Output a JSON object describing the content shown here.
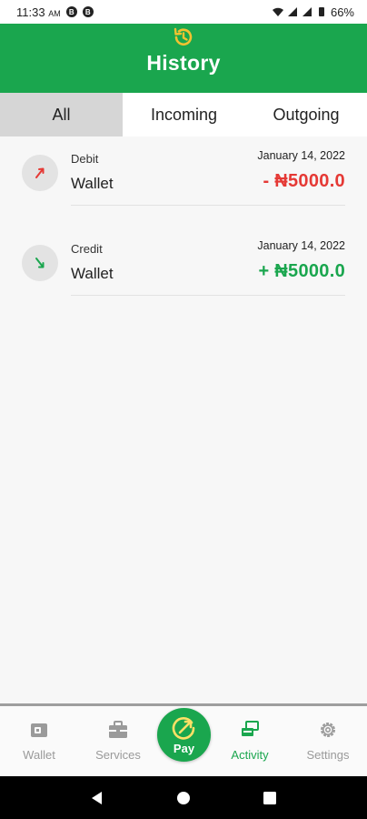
{
  "status_bar": {
    "time": "11:33",
    "ampm": "AM",
    "battery": "66%",
    "icons": [
      "notification-badge-icon",
      "notification-badge-icon",
      "wifi-icon",
      "signal-icon",
      "signal-icon",
      "battery-icon"
    ]
  },
  "header": {
    "title": "History",
    "icon": "history-icon"
  },
  "tabs": [
    {
      "label": "All",
      "active": true
    },
    {
      "label": "Incoming",
      "active": false
    },
    {
      "label": "Outgoing",
      "active": false
    }
  ],
  "transactions": [
    {
      "type": "Debit",
      "account": "Wallet",
      "date": "January 14, 2022",
      "amount": "- ₦5000.0",
      "direction": "out",
      "color": "#e53935",
      "icon": "arrow-up-right-icon"
    },
    {
      "type": "Credit",
      "account": "Wallet",
      "date": "January 14, 2022",
      "amount": "+ ₦5000.0",
      "direction": "in",
      "color": "#1aa64e",
      "icon": "arrow-down-right-icon"
    }
  ],
  "bottom_nav": {
    "items": [
      {
        "label": "Wallet",
        "icon": "wallet-icon",
        "active": false
      },
      {
        "label": "Services",
        "icon": "briefcase-icon",
        "active": false
      },
      {
        "label": "Activity",
        "icon": "activity-icon",
        "active": true
      },
      {
        "label": "Settings",
        "icon": "gear-icon",
        "active": false
      }
    ],
    "pay_label": "Pay"
  },
  "colors": {
    "accent": "#1aa64e",
    "debit": "#e53935",
    "credit": "#1aa64e",
    "history_icon": "#f2c230"
  }
}
